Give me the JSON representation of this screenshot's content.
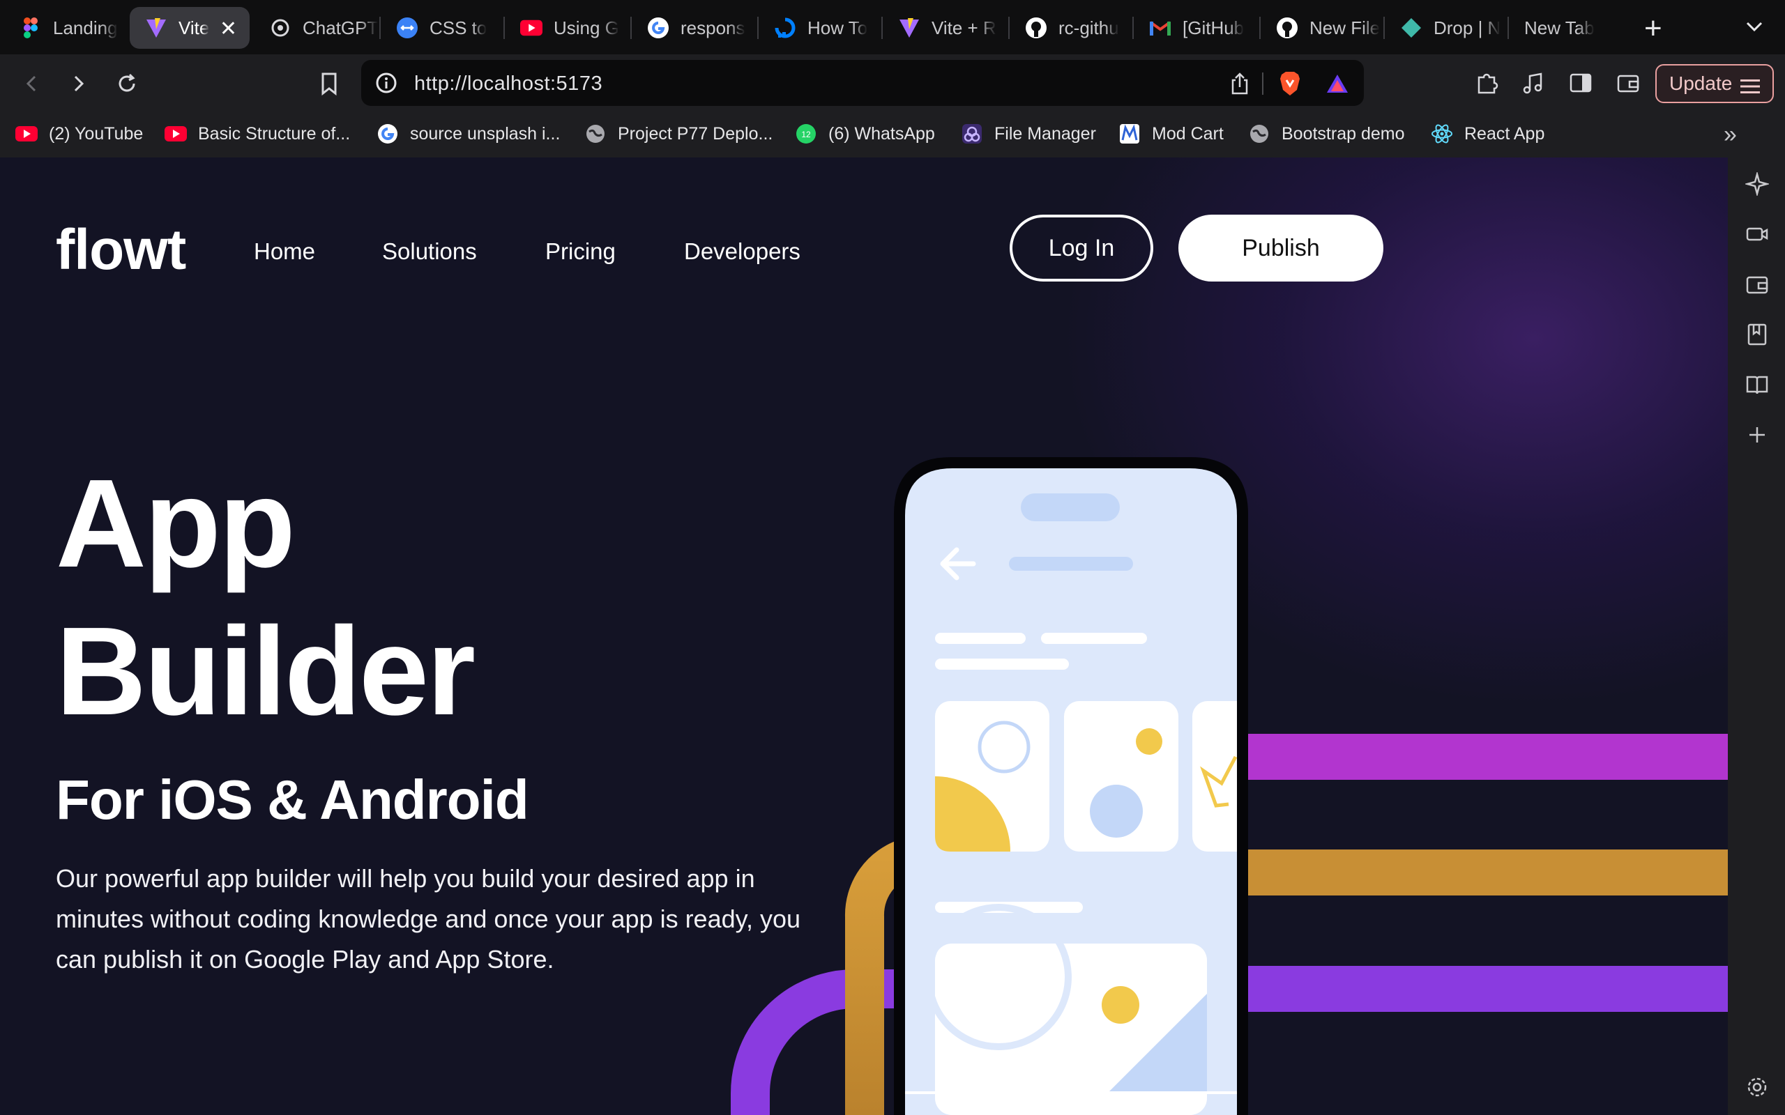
{
  "browser": {
    "tabs": [
      {
        "label": "Landing",
        "icon": "figma-icon"
      },
      {
        "label": "Vite",
        "icon": "vite-icon",
        "active": true
      },
      {
        "label": "ChatGPT",
        "icon": "chatgpt-icon"
      },
      {
        "label": "CSS to",
        "icon": "css-icon"
      },
      {
        "label": "Using G",
        "icon": "youtube-icon"
      },
      {
        "label": "respons",
        "icon": "google-icon"
      },
      {
        "label": "How To",
        "icon": "digitalocean-icon"
      },
      {
        "label": "Vite + R",
        "icon": "vite-icon"
      },
      {
        "label": "rc-githu",
        "icon": "github-icon"
      },
      {
        "label": "[GitHub",
        "icon": "gmail-icon"
      },
      {
        "label": "New File",
        "icon": "github-icon"
      },
      {
        "label": "Drop | N",
        "icon": "drop-icon"
      },
      {
        "label": "New Tab",
        "icon": ""
      }
    ],
    "url": "http://localhost:5173",
    "update_label": "Update",
    "bookmarks": [
      {
        "label": "(2) YouTube",
        "icon": "youtube-icon"
      },
      {
        "label": "Basic Structure of...",
        "icon": "youtube-icon"
      },
      {
        "label": "source unsplash i...",
        "icon": "google-icon"
      },
      {
        "label": "Project P77 Deplo...",
        "icon": "globe-icon"
      },
      {
        "label": "(6) WhatsApp",
        "icon": "whatsapp-icon"
      },
      {
        "label": "File Manager",
        "icon": "file-manager-icon"
      },
      {
        "label": "Mod Cart",
        "icon": "modcart-icon"
      },
      {
        "label": "Bootstrap demo",
        "icon": "globe-icon"
      },
      {
        "label": "React App",
        "icon": "react-icon"
      }
    ]
  },
  "site": {
    "logo": "flowt",
    "nav": [
      "Home",
      "Solutions",
      "Pricing",
      "Developers"
    ],
    "login_label": "Log In",
    "publish_label": "Publish",
    "hero_title_line1": "App",
    "hero_title_line2": "Builder",
    "hero_subtitle": "For iOS & Android",
    "hero_description": "Our powerful app builder will help you build your desired app in minutes without coding knowledge and once your app is ready, you can publish it on Google Play and App Store."
  },
  "colors": {
    "page_bg": "#131324",
    "stripe_magenta": "#b235cf",
    "stripe_gold": "#c88f35",
    "stripe_purple": "#8a3be0",
    "phone_screen": "#dde8fb",
    "accent_yellow": "#f2c94c",
    "accent_blue": "#c3d7f8"
  }
}
